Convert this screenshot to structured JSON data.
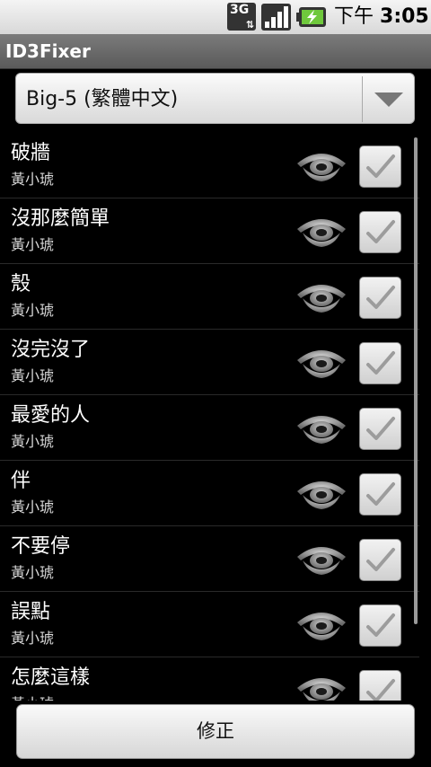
{
  "status_bar": {
    "network": "3G",
    "time_period": "下午",
    "time": "3:05"
  },
  "app": {
    "title": "ID3Fixer"
  },
  "encoding_spinner": {
    "selected": "Big-5 (繁體中文)"
  },
  "songs": [
    {
      "title": "破牆",
      "artist": "黃小琥"
    },
    {
      "title": "沒那麼簡單",
      "artist": "黃小琥"
    },
    {
      "title": "殼",
      "artist": "黃小琥"
    },
    {
      "title": "沒完沒了",
      "artist": "黃小琥"
    },
    {
      "title": "最愛的人",
      "artist": "黃小琥"
    },
    {
      "title": "伴",
      "artist": "黃小琥"
    },
    {
      "title": "不要停",
      "artist": "黃小琥"
    },
    {
      "title": "誤點",
      "artist": "黃小琥"
    },
    {
      "title": "怎麼這樣",
      "artist": "黃小琥"
    }
  ],
  "row_icons": {
    "preview": "eye-icon",
    "select": "checkmark-icon"
  },
  "fix_button": {
    "label": "修正"
  },
  "colors": {
    "title_bar": "#6b6b6b",
    "background": "#000000",
    "status_bar": "#e6e6e6"
  }
}
